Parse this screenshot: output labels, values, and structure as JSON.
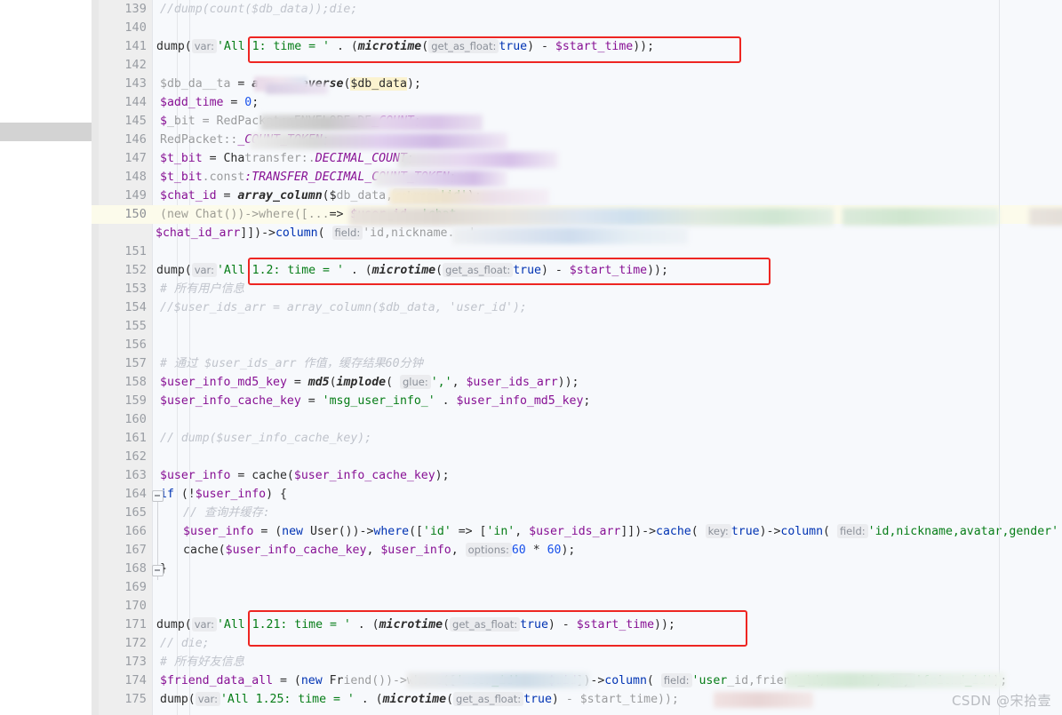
{
  "app": {
    "kind": "code-editor",
    "language": "PHP",
    "theme_background": "#f7f9fc",
    "gutter_background": "#eeeeee",
    "current_line_highlight": "#fcfbeb",
    "annotation_color": "#ee2622"
  },
  "watermark": {
    "text": "CSDN @宋拾壹"
  },
  "gutter": {
    "first_line": 139,
    "last_line": 175,
    "current_line": 150,
    "fold_marker_lines": [
      164,
      168
    ]
  },
  "lines": [
    {
      "no": "139",
      "segments": [
        {
          "t": "comment",
          "v": "//dump(count($db_data));die;"
        }
      ]
    },
    {
      "no": "140",
      "segments": []
    },
    {
      "no": "141",
      "boxed": true,
      "segments": [
        {
          "t": "plain",
          "v": "dump("
        },
        {
          "t": "hint",
          "v": "var:"
        },
        {
          "t": "string",
          "v": "'All 1: time = '"
        },
        {
          "t": "plain",
          "v": " . ("
        },
        {
          "t": "function",
          "v": "microtime"
        },
        {
          "t": "plain",
          "v": "("
        },
        {
          "t": "hint",
          "v": "get_as_float:"
        },
        {
          "t": "keyword",
          "v": "true"
        },
        {
          "t": "plain",
          "v": ") - "
        },
        {
          "t": "phpvar",
          "v": "$start_time"
        },
        {
          "t": "plain",
          "v": "));"
        }
      ]
    },
    {
      "no": "142",
      "segments": []
    },
    {
      "no": "143",
      "redacted": true,
      "segments": [
        {
          "t": "redacted",
          "v": "$db_da__ta"
        },
        {
          "t": "plain",
          "v": " = "
        },
        {
          "t": "function",
          "v": "array_reverse"
        },
        {
          "t": "plain",
          "v": "("
        },
        {
          "t": "highlight",
          "v": "$db_data"
        },
        {
          "t": "plain",
          "v": ");"
        }
      ]
    },
    {
      "no": "144",
      "segments": [
        {
          "t": "phpvar",
          "v": "$add_time"
        },
        {
          "t": "plain",
          "v": " = "
        },
        {
          "t": "number",
          "v": "0"
        },
        {
          "t": "plain",
          "v": ";"
        }
      ]
    },
    {
      "no": "145",
      "redacted": true,
      "segments": [
        {
          "t": "phpvar",
          "v": "$"
        },
        {
          "t": "redacted",
          "v": "_bit = RedPacket::ENVELOPE_DE"
        },
        {
          "t": "const",
          "v": "_COUNT"
        },
        {
          "t": "plain",
          "v": ";"
        }
      ]
    },
    {
      "no": "146",
      "redacted": true,
      "segments": [
        {
          "t": "redacted",
          "v": "RedPacket::"
        },
        {
          "t": "const",
          "v": "_COUNT_TOKEN"
        },
        {
          "t": "plain",
          "v": ";"
        }
      ]
    },
    {
      "no": "147",
      "redacted": true,
      "segments": [
        {
          "t": "phpvar",
          "v": "$t_bit"
        },
        {
          "t": "plain",
          "v": " = Cha"
        },
        {
          "t": "redacted",
          "v": "transfer:."
        },
        {
          "t": "const",
          "v": "DECIMAL_COUNT"
        },
        {
          "t": "plain",
          "v": ";"
        }
      ]
    },
    {
      "no": "148",
      "redacted": true,
      "segments": [
        {
          "t": "phpvar",
          "v": "$t_bit"
        },
        {
          "t": "redacted",
          "v": ".const"
        },
        {
          "t": "const",
          "v": ":TRANSFER_DECIMAL_COUNT_TOKEN"
        },
        {
          "t": "plain",
          "v": ";"
        }
      ]
    },
    {
      "no": "149",
      "redacted": true,
      "segments": [
        {
          "t": "phpvar",
          "v": "$chat_id"
        },
        {
          "t": "plain",
          "v": " = "
        },
        {
          "t": "function",
          "v": "array_column"
        },
        {
          "t": "plain",
          "v": "($"
        },
        {
          "t": "redacted",
          "v": "db_data,"
        },
        {
          "t": "hint",
          "v": "column:"
        },
        {
          "t": "string",
          "v": "'id'"
        },
        {
          "t": "plain",
          "v": ");"
        }
      ]
    },
    {
      "no": "150",
      "current": true,
      "redacted": true,
      "segments": [
        {
          "t": "redacted",
          "v": "(new Chat())->where([..."
        },
        {
          "t": "plain",
          "v": "=> "
        },
        {
          "t": "phpvar",
          "v": "$user_id"
        },
        {
          "t": "plain",
          "v": ", "
        },
        {
          "t": "string",
          "v": "'chat_"
        }
      ]
    },
    {
      "no": "",
      "wrap": true,
      "redacted": true,
      "segments": [
        {
          "t": "phpvar",
          "v": "$chat_id_arr"
        },
        {
          "t": "plain",
          "v": "]])->"
        },
        {
          "t": "method",
          "v": "column"
        },
        {
          "t": "plain",
          "v": "( "
        },
        {
          "t": "hint",
          "v": "field:"
        },
        {
          "t": "redacted",
          "v": "'id,nickname...'"
        }
      ]
    },
    {
      "no": "151",
      "segments": []
    },
    {
      "no": "152",
      "boxed": true,
      "segments": [
        {
          "t": "plain",
          "v": "dump("
        },
        {
          "t": "hint",
          "v": "var:"
        },
        {
          "t": "string",
          "v": "'All 1.2: time = '"
        },
        {
          "t": "plain",
          "v": " . ("
        },
        {
          "t": "function",
          "v": "microtime"
        },
        {
          "t": "plain",
          "v": "("
        },
        {
          "t": "hint",
          "v": "get_as_float:"
        },
        {
          "t": "keyword",
          "v": "true"
        },
        {
          "t": "plain",
          "v": ") - "
        },
        {
          "t": "phpvar",
          "v": "$start_time"
        },
        {
          "t": "plain",
          "v": "));"
        }
      ]
    },
    {
      "no": "153",
      "segments": [
        {
          "t": "comment",
          "v": "# 所有用户信息"
        }
      ]
    },
    {
      "no": "154",
      "segments": [
        {
          "t": "comment",
          "v": "//$user_ids_arr = array_column($db_data, 'user_id');"
        }
      ]
    },
    {
      "no": "155",
      "segments": []
    },
    {
      "no": "156",
      "segments": []
    },
    {
      "no": "157",
      "segments": [
        {
          "t": "comment",
          "v": "# 通过 $user_ids_arr 作值，缓存结果60分钟"
        }
      ]
    },
    {
      "no": "158",
      "segments": [
        {
          "t": "phpvar",
          "v": "$user_info_md5_key"
        },
        {
          "t": "plain",
          "v": " = "
        },
        {
          "t": "function",
          "v": "md5"
        },
        {
          "t": "plain",
          "v": "("
        },
        {
          "t": "function",
          "v": "implode"
        },
        {
          "t": "plain",
          "v": "( "
        },
        {
          "t": "hint",
          "v": "glue:"
        },
        {
          "t": "string",
          "v": "','"
        },
        {
          "t": "plain",
          "v": ", "
        },
        {
          "t": "phpvar",
          "v": "$user_ids_arr"
        },
        {
          "t": "plain",
          "v": "));"
        }
      ]
    },
    {
      "no": "159",
      "segments": [
        {
          "t": "phpvar",
          "v": "$user_info_cache_key"
        },
        {
          "t": "plain",
          "v": " = "
        },
        {
          "t": "string",
          "v": "'msg_user_info_'"
        },
        {
          "t": "plain",
          "v": " . "
        },
        {
          "t": "phpvar",
          "v": "$user_info_md5_key"
        },
        {
          "t": "plain",
          "v": ";"
        }
      ]
    },
    {
      "no": "160",
      "segments": []
    },
    {
      "no": "161",
      "segments": [
        {
          "t": "comment",
          "v": "// dump($user_info_cache_key);"
        }
      ]
    },
    {
      "no": "162",
      "segments": []
    },
    {
      "no": "163",
      "segments": [
        {
          "t": "phpvar",
          "v": "$user_info"
        },
        {
          "t": "plain",
          "v": " = cache("
        },
        {
          "t": "phpvar",
          "v": "$user_info_cache_key"
        },
        {
          "t": "plain",
          "v": ");"
        }
      ]
    },
    {
      "no": "164",
      "fold": true,
      "segments": [
        {
          "t": "keyword",
          "v": "if"
        },
        {
          "t": "plain",
          "v": " (!"
        },
        {
          "t": "phpvar",
          "v": "$user_info"
        },
        {
          "t": "plain",
          "v": ") {"
        }
      ]
    },
    {
      "no": "165",
      "segments": [
        {
          "t": "comment",
          "v": "// 查询并缓存:"
        }
      ]
    },
    {
      "no": "166",
      "segments": [
        {
          "t": "phpvar",
          "v": "$user_info"
        },
        {
          "t": "plain",
          "v": " = ("
        },
        {
          "t": "keyword",
          "v": "new"
        },
        {
          "t": "plain",
          "v": " User())->"
        },
        {
          "t": "method",
          "v": "where"
        },
        {
          "t": "plain",
          "v": "(["
        },
        {
          "t": "string",
          "v": "'id'"
        },
        {
          "t": "plain",
          "v": " => ["
        },
        {
          "t": "string",
          "v": "'in'"
        },
        {
          "t": "plain",
          "v": ", "
        },
        {
          "t": "phpvar",
          "v": "$user_ids_arr"
        },
        {
          "t": "plain",
          "v": "]])->"
        },
        {
          "t": "method",
          "v": "cache"
        },
        {
          "t": "plain",
          "v": "( "
        },
        {
          "t": "hint",
          "v": "key:"
        },
        {
          "t": "keyword",
          "v": "true"
        },
        {
          "t": "plain",
          "v": ")->"
        },
        {
          "t": "method",
          "v": "column"
        },
        {
          "t": "plain",
          "v": "( "
        },
        {
          "t": "hint",
          "v": "field:"
        },
        {
          "t": "string",
          "v": "'id,nickname,avatar,gender'"
        }
      ]
    },
    {
      "no": "167",
      "segments": [
        {
          "t": "plain",
          "v": "cache("
        },
        {
          "t": "phpvar",
          "v": "$user_info_cache_key"
        },
        {
          "t": "plain",
          "v": ", "
        },
        {
          "t": "phpvar",
          "v": "$user_info"
        },
        {
          "t": "plain",
          "v": ", "
        },
        {
          "t": "hint",
          "v": "options:"
        },
        {
          "t": "number",
          "v": "60"
        },
        {
          "t": "plain",
          "v": " * "
        },
        {
          "t": "number",
          "v": "60"
        },
        {
          "t": "plain",
          "v": ");"
        }
      ]
    },
    {
      "no": "168",
      "fold": true,
      "segments": [
        {
          "t": "plain",
          "v": "}"
        }
      ]
    },
    {
      "no": "169",
      "segments": []
    },
    {
      "no": "170",
      "segments": []
    },
    {
      "no": "171",
      "boxed": true,
      "segments": [
        {
          "t": "plain",
          "v": "dump("
        },
        {
          "t": "hint",
          "v": "var:"
        },
        {
          "t": "string",
          "v": "'All 1.21: time = '"
        },
        {
          "t": "plain",
          "v": " . ("
        },
        {
          "t": "function",
          "v": "microtime"
        },
        {
          "t": "plain",
          "v": "("
        },
        {
          "t": "hint",
          "v": "get_as_float:"
        },
        {
          "t": "keyword",
          "v": "true"
        },
        {
          "t": "plain",
          "v": ") - "
        },
        {
          "t": "phpvar",
          "v": "$start_time"
        },
        {
          "t": "plain",
          "v": "));"
        }
      ]
    },
    {
      "no": "172",
      "segments": [
        {
          "t": "comment",
          "v": "// die;"
        }
      ]
    },
    {
      "no": "173",
      "segments": [
        {
          "t": "comment",
          "v": "# 所有好友信息"
        }
      ]
    },
    {
      "no": "174",
      "redacted": true,
      "segments": [
        {
          "t": "phpvar",
          "v": "$friend_data_all"
        },
        {
          "t": "plain",
          "v": " = ("
        },
        {
          "t": "keyword",
          "v": "new"
        },
        {
          "t": "plain",
          "v": " Fr"
        },
        {
          "t": "redacted",
          "v": "iend())->where(["
        },
        {
          "t": "string",
          "v": "'user_id'"
        },
        {
          "t": "plain",
          "v": " => "
        },
        {
          "t": "phpvar",
          "v": "$uid"
        },
        {
          "t": "plain",
          "v": "])->"
        },
        {
          "t": "method",
          "v": "column"
        },
        {
          "t": "plain",
          "v": "( "
        },
        {
          "t": "hint",
          "v": "field:"
        },
        {
          "t": "string",
          "v": "'user"
        },
        {
          "t": "redacted",
          "v": "_id,friend_id,remark'"
        },
        {
          "t": "plain",
          "v": ", "
        },
        {
          "t": "hint",
          "v": "key:"
        },
        {
          "t": "string",
          "v": "'friend_id'"
        },
        {
          "t": "plain",
          "v": ");"
        }
      ]
    },
    {
      "no": "175",
      "redacted": true,
      "segments": [
        {
          "t": "plain",
          "v": "dump("
        },
        {
          "t": "hint",
          "v": "var:"
        },
        {
          "t": "string",
          "v": "'All 1.25: time = '"
        },
        {
          "t": "plain",
          "v": " . ("
        },
        {
          "t": "function",
          "v": "microtime"
        },
        {
          "t": "plain",
          "v": "("
        },
        {
          "t": "hint",
          "v": "get_as_float:"
        },
        {
          "t": "keyword",
          "v": "true"
        },
        {
          "t": "plain",
          "v": ")"
        },
        {
          "t": "redacted",
          "v": " - $start_time));"
        }
      ]
    }
  ],
  "annotations": {
    "boxes": [
      {
        "label": "All 1 timing dump",
        "line": 141
      },
      {
        "label": "All 1.2 timing dump",
        "line": 152
      },
      {
        "label": "All 1.21 timing dump",
        "line": 171
      }
    ]
  },
  "colors": {
    "keyword": "#0033b3",
    "string": "#067d17",
    "number": "#1750eb",
    "comment": "#c0c4cc",
    "variable": "#871094",
    "hint_bg": "#ebecef",
    "hint_fg": "#8b9099"
  }
}
